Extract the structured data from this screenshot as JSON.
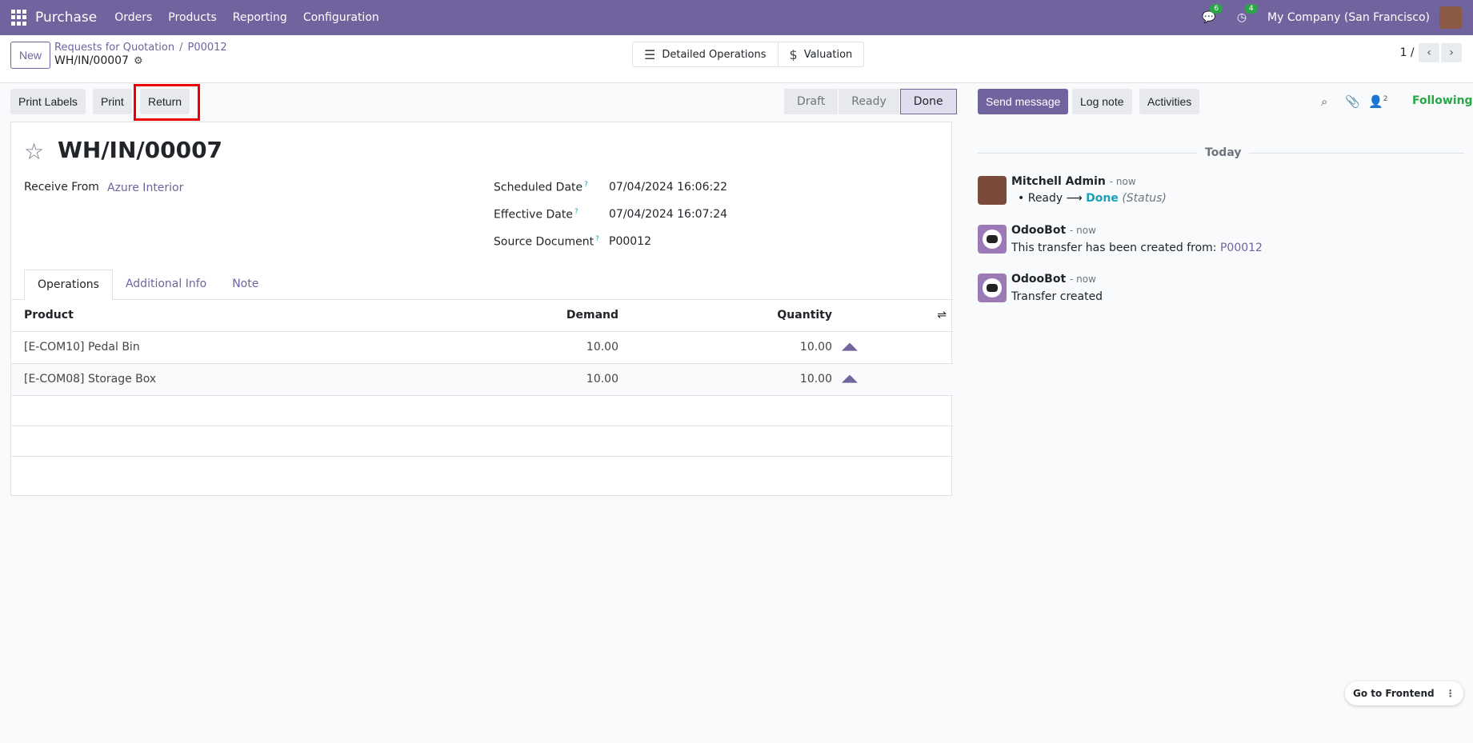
{
  "navbar": {
    "app_name": "Purchase",
    "menu": [
      "Orders",
      "Products",
      "Reporting",
      "Configuration"
    ],
    "messages_count": "6",
    "activities_count": "4",
    "company": "My Company (San Francisco)"
  },
  "control": {
    "new_label": "New",
    "breadcrumb": [
      "Requests for Quotation",
      "P00012"
    ],
    "breadcrumb_sep": "/",
    "record": "WH/IN/00007",
    "smart_buttons": [
      "Detailed Operations",
      "Valuation"
    ],
    "pager": "1 / 1"
  },
  "actions": {
    "print_labels": "Print Labels",
    "print": "Print",
    "return": "Return"
  },
  "status": {
    "steps": [
      "Draft",
      "Ready",
      "Done"
    ],
    "current": "Done"
  },
  "form": {
    "title": "WH/IN/00007",
    "receive_from_label": "Receive From",
    "receive_from": "Azure Interior",
    "scheduled_date_label": "Scheduled Date",
    "scheduled_date": "07/04/2024 16:06:22",
    "effective_date_label": "Effective Date",
    "effective_date": "07/04/2024 16:07:24",
    "source_doc_label": "Source Document",
    "source_doc": "P00012",
    "help_mark": "?",
    "tabs": [
      "Operations",
      "Additional Info",
      "Note"
    ],
    "columns": [
      "Product",
      "Demand",
      "Quantity"
    ],
    "rows": [
      {
        "product": "[E-COM10] Pedal Bin",
        "demand": "10.00",
        "quantity": "10.00"
      },
      {
        "product": "[E-COM08] Storage Box",
        "demand": "10.00",
        "quantity": "10.00"
      }
    ]
  },
  "chatter": {
    "send_message": "Send message",
    "log_note": "Log note",
    "activities": "Activities",
    "followers_count": "2",
    "following": "Following",
    "today": "Today",
    "messages": [
      {
        "author": "Mitchell Admin",
        "time": "- now",
        "from": "Ready",
        "to": "Done",
        "field": "(Status)"
      },
      {
        "author": "OdooBot",
        "time": "- now",
        "text": "This transfer has been created from:",
        "link": "P00012"
      },
      {
        "author": "OdooBot",
        "time": "- now",
        "text": "Transfer created"
      }
    ]
  },
  "frontend": "Go to Frontend",
  "colors": {
    "brand": "#71639e",
    "highlight": "#e00000"
  }
}
